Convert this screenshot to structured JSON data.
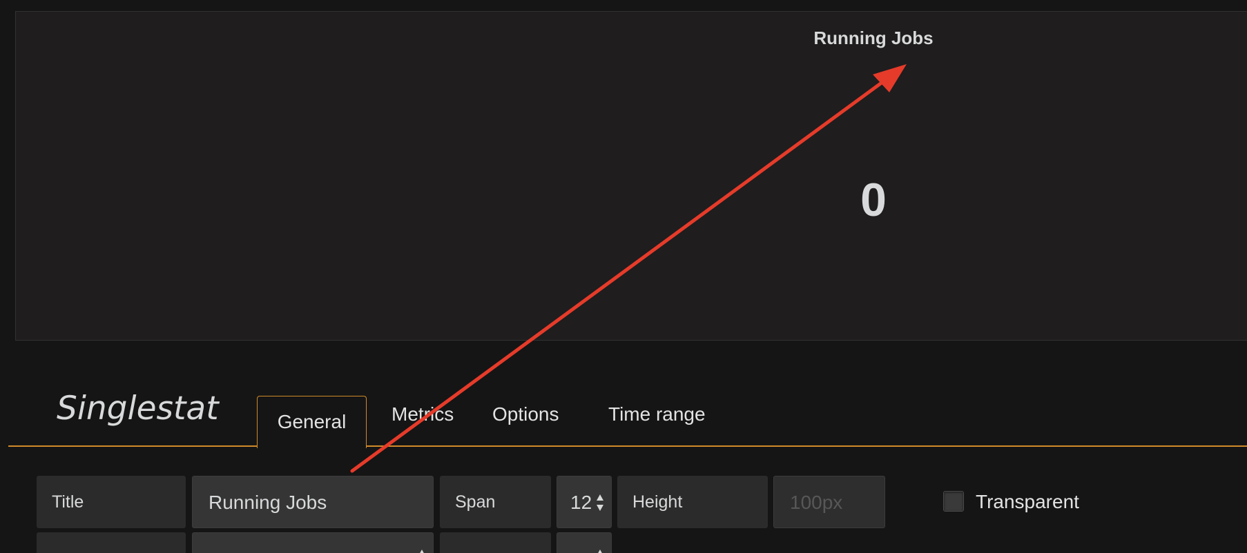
{
  "panel": {
    "title": "Running Jobs",
    "value": "0"
  },
  "editor": {
    "title": "Singlestat",
    "tabs": [
      {
        "label": "General",
        "active": true
      },
      {
        "label": "Metrics",
        "active": false
      },
      {
        "label": "Options",
        "active": false
      },
      {
        "label": "Time range",
        "active": false
      }
    ]
  },
  "general_form": {
    "title_label": "Title",
    "title_value": "Running Jobs",
    "span_label": "Span",
    "span_value": "12",
    "height_label": "Height",
    "height_placeholder": "100px",
    "transparent_label": "Transparent"
  },
  "colors": {
    "accent": "#d28b2a",
    "annotation_arrow": "#e63b2a",
    "panel_bg": "#1f1d1e",
    "page_bg": "#151515"
  }
}
